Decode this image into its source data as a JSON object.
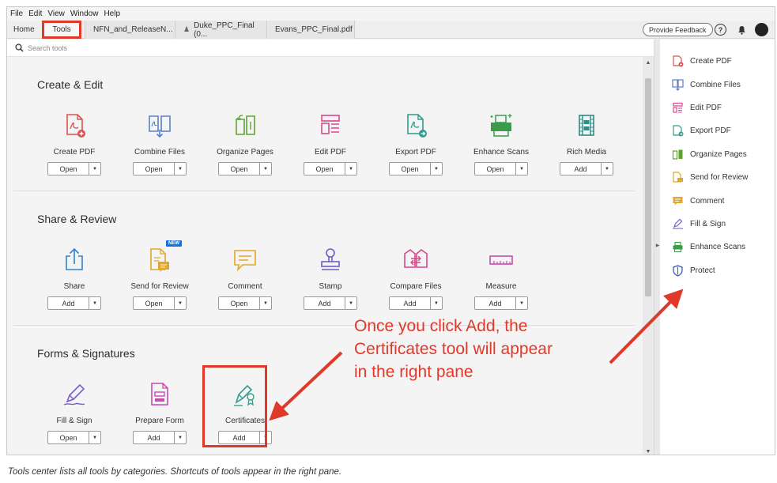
{
  "menu": [
    "File",
    "Edit",
    "View",
    "Window",
    "Help"
  ],
  "tabs": {
    "home": "Home",
    "tools": "Tools",
    "docs": [
      "NFN_and_ReleaseN...",
      "Duke_PPC_Final (0...",
      "Evans_PPC_Final.pdf"
    ]
  },
  "header": {
    "feedback": "Provide Feedback",
    "help": "?"
  },
  "search": {
    "placeholder": "Search tools"
  },
  "sections": [
    {
      "title": "Create & Edit",
      "tools": [
        {
          "label": "Create PDF",
          "button": "Open",
          "icon": "create-pdf-icon"
        },
        {
          "label": "Combine Files",
          "button": "Open",
          "icon": "combine-files-icon"
        },
        {
          "label": "Organize Pages",
          "button": "Open",
          "icon": "organize-pages-icon"
        },
        {
          "label": "Edit PDF",
          "button": "Open",
          "icon": "edit-pdf-icon"
        },
        {
          "label": "Export PDF",
          "button": "Open",
          "icon": "export-pdf-icon"
        },
        {
          "label": "Enhance Scans",
          "button": "Open",
          "icon": "enhance-scans-icon"
        },
        {
          "label": "Rich Media",
          "button": "Add",
          "icon": "rich-media-icon"
        }
      ]
    },
    {
      "title": "Share & Review",
      "tools": [
        {
          "label": "Share",
          "button": "Add",
          "icon": "share-icon"
        },
        {
          "label": "Send for Review",
          "button": "Open",
          "icon": "send-for-review-icon",
          "badge": "NEW"
        },
        {
          "label": "Comment",
          "button": "Open",
          "icon": "comment-icon"
        },
        {
          "label": "Stamp",
          "button": "Add",
          "icon": "stamp-icon"
        },
        {
          "label": "Compare Files",
          "button": "Add",
          "icon": "compare-files-icon"
        },
        {
          "label": "Measure",
          "button": "Add",
          "icon": "measure-icon"
        }
      ]
    },
    {
      "title": "Forms & Signatures",
      "tools": [
        {
          "label": "Fill & Sign",
          "button": "Open",
          "icon": "fill-sign-icon"
        },
        {
          "label": "Prepare Form",
          "button": "Add",
          "icon": "prepare-form-icon"
        },
        {
          "label": "Certificates",
          "button": "Add",
          "icon": "certificates-icon"
        }
      ]
    }
  ],
  "right_pane": [
    "Create PDF",
    "Combine Files",
    "Edit PDF",
    "Export PDF",
    "Organize Pages",
    "Send for Review",
    "Comment",
    "Fill & Sign",
    "Enhance Scans",
    "Protect"
  ],
  "annotation": [
    "Once you click Add, the",
    "Certificates tool will appear",
    "in the right pane"
  ],
  "caption": "Tools center lists all tools by categories. Shortcuts of tools appear in the right pane.",
  "colors": {
    "highlight": "#e0392a",
    "badge": "#1473e6"
  }
}
